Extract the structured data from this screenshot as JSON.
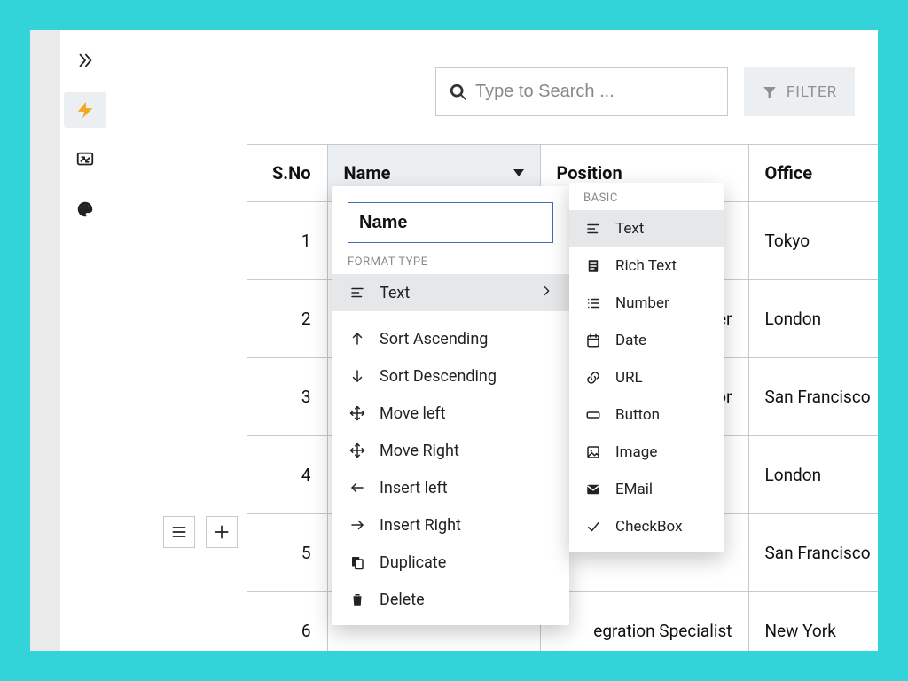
{
  "rail": {
    "expand_tip": "Expand",
    "lightning_tip": "Quick",
    "sync_tip": "Sync",
    "palette_tip": "Theme"
  },
  "topbar": {
    "search_placeholder": "Type to Search ...",
    "filter_label": "FILTER"
  },
  "table": {
    "headers": {
      "sno": "S.No",
      "name": "Name",
      "position": "Position",
      "office": "Office"
    },
    "rows": [
      {
        "sno": "1",
        "name": "",
        "position": "",
        "office": "Tokyo"
      },
      {
        "sno": "2",
        "name": "",
        "position": "er",
        "office": "London"
      },
      {
        "sno": "3",
        "name": "",
        "position": "hor",
        "office": "San Francisco"
      },
      {
        "sno": "4",
        "name": "",
        "position": "",
        "office": "London"
      },
      {
        "sno": "5",
        "name": "",
        "position": "",
        "office": "San Francisco"
      },
      {
        "sno": "6",
        "name": "",
        "position": "egration Specialist",
        "office": "New York"
      }
    ]
  },
  "row_tools": {
    "menu_tip": "Row menu",
    "add_tip": "Add row"
  },
  "col_menu": {
    "name_value": "Name",
    "format_label": "FORMAT TYPE",
    "text_label": "Text",
    "sort_asc": "Sort Ascending",
    "sort_desc": "Sort Descending",
    "move_left": "Move left",
    "move_right": "Move Right",
    "insert_left": "Insert left",
    "insert_right": "Insert Right",
    "duplicate": "Duplicate",
    "delete": "Delete"
  },
  "format_submenu": {
    "basic_label": "BASIC",
    "text": "Text",
    "rich_text": "Rich Text",
    "number": "Number",
    "date": "Date",
    "url": "URL",
    "button": "Button",
    "image": "Image",
    "email": "EMail",
    "checkbox": "CheckBox"
  }
}
